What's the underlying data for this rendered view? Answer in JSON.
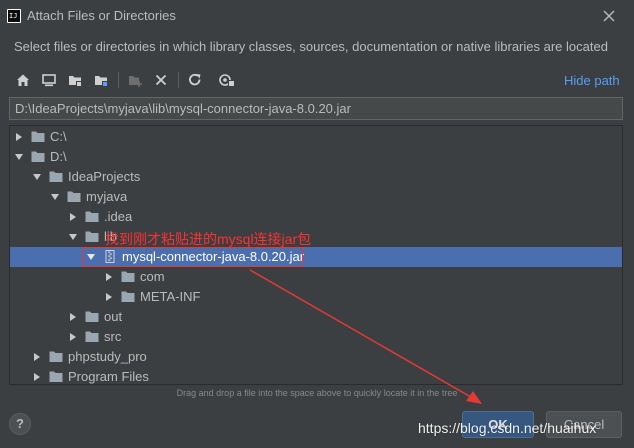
{
  "window": {
    "title": "Attach Files or Directories",
    "description": "Select files or directories in which library classes, sources, documentation or native libraries are located"
  },
  "toolbar": {
    "buttons": [
      {
        "icon": "home-icon"
      },
      {
        "icon": "desktop-icon"
      },
      {
        "icon": "project-folder-icon"
      },
      {
        "icon": "module-folder-icon"
      },
      {
        "icon": "new-folder-icon"
      },
      {
        "icon": "delete-icon"
      },
      {
        "icon": "refresh-icon"
      },
      {
        "icon": "show-hidden-icon"
      }
    ],
    "hide_path_label": "Hide path"
  },
  "path_field": {
    "value": "D:\\IdeaProjects\\myjava\\lib\\mysql-connector-java-8.0.20.jar"
  },
  "tree": {
    "items": [
      {
        "label": "C:\\",
        "level": 0,
        "expanded": false,
        "type": "folder",
        "selected": false
      },
      {
        "label": "D:\\",
        "level": 0,
        "expanded": true,
        "type": "folder",
        "selected": false
      },
      {
        "label": "IdeaProjects",
        "level": 1,
        "expanded": true,
        "type": "folder",
        "selected": false
      },
      {
        "label": "myjava",
        "level": 2,
        "expanded": true,
        "type": "folder",
        "selected": false
      },
      {
        "label": ".idea",
        "level": 3,
        "expanded": false,
        "type": "folder",
        "selected": false
      },
      {
        "label": "lib",
        "level": 3,
        "expanded": true,
        "type": "folder",
        "selected": false
      },
      {
        "label": "mysql-connector-java-8.0.20.jar",
        "level": 4,
        "expanded": true,
        "type": "jar",
        "selected": true
      },
      {
        "label": "com",
        "level": 5,
        "expanded": false,
        "type": "folder",
        "selected": false
      },
      {
        "label": "META-INF",
        "level": 5,
        "expanded": false,
        "type": "folder",
        "selected": false
      },
      {
        "label": "out",
        "level": 3,
        "expanded": false,
        "type": "folder",
        "selected": false
      },
      {
        "label": "src",
        "level": 3,
        "expanded": false,
        "type": "folder",
        "selected": false
      },
      {
        "label": "phpstudy_pro",
        "level": 1,
        "expanded": false,
        "type": "folder",
        "selected": false
      },
      {
        "label": "Program Files",
        "level": 1,
        "expanded": false,
        "type": "folder",
        "selected": false
      }
    ]
  },
  "drop_hint": "Drag and drop a file into the space above to quickly locate it in the tree",
  "buttons": {
    "help": "?",
    "ok": "OK",
    "cancel": "Cancel"
  },
  "annotation": {
    "text": "找到刚才粘贴进的mysql连接jar包",
    "color": "#ff3030"
  },
  "watermark": "https://blog.csdn.net/huaihux",
  "colors": {
    "background": "#3c3f41",
    "text": "#bbbbbb",
    "selection": "#4b6eaf",
    "link": "#589df6",
    "ok_button": "#365880"
  }
}
